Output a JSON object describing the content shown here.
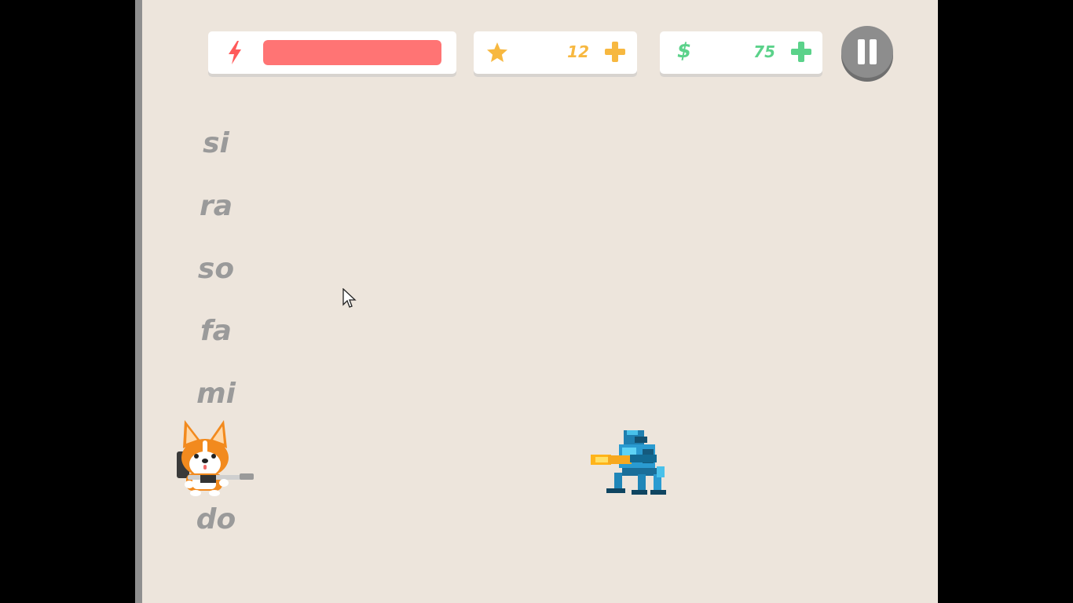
{
  "hud": {
    "energy": {
      "icon": "lightning-icon",
      "level_percent": 100,
      "color": "#ff7474"
    },
    "stars": {
      "icon": "star-icon",
      "count": "12",
      "color": "#f7b840"
    },
    "money": {
      "icon": "dollar-icon",
      "symbol": "$",
      "amount": "75",
      "color": "#5bd28a"
    },
    "pause": {
      "icon": "pause-icon"
    }
  },
  "notes": [
    "si",
    "ra",
    "so",
    "fa",
    "mi",
    "do"
  ],
  "characters": {
    "player": "corgi-gunner",
    "enemy": "robot-gunner"
  },
  "colors": {
    "background": "#ede5dc",
    "note_text": "#9a9a9a"
  }
}
